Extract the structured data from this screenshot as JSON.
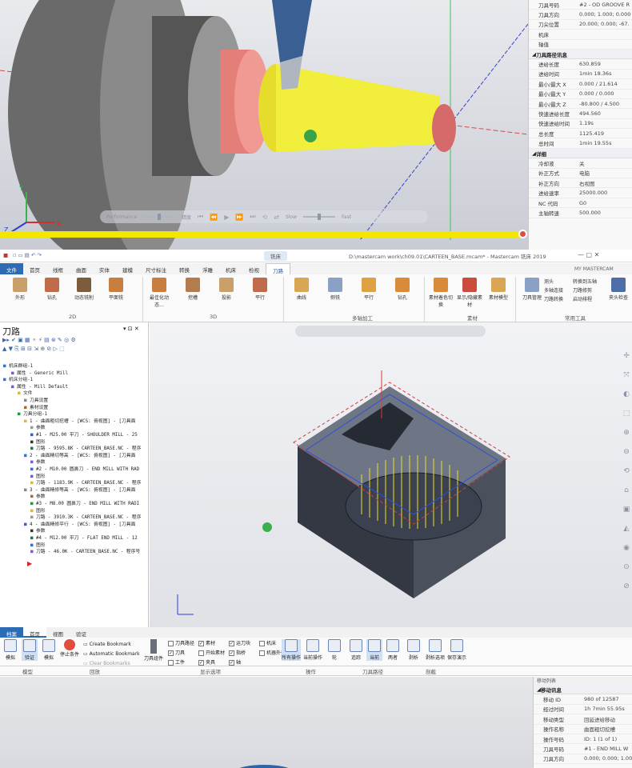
{
  "panel1": {
    "playbar": {
      "performance": "Performance",
      "accuracy": "精度",
      "slow": "Slow",
      "fast": "Fast"
    },
    "props": {
      "top_rows": [
        {
          "k": "刀具号码",
          "v": "#2 - OD GROOVE R"
        },
        {
          "k": "刀具方向",
          "v": "0.000; 1.000; 0.000"
        },
        {
          "k": "刀尖位置",
          "v": "20.000; 0.000; -67."
        },
        {
          "k": "机床",
          "v": ""
        },
        {
          "k": "轴值",
          "v": ""
        }
      ],
      "section1": "刀具路径讯息",
      "rows1": [
        {
          "k": "进给长度",
          "v": "630.859"
        },
        {
          "k": "进给时间",
          "v": "1min 18.36s"
        },
        {
          "k": "最小/最大 X",
          "v": "0.000 / 21.614"
        },
        {
          "k": "最小/最大 Y",
          "v": "0.000 / 0.000"
        },
        {
          "k": "最小/最大 Z",
          "v": "-80.800 / 4.500"
        },
        {
          "k": "快速进给长度",
          "v": "494.560"
        },
        {
          "k": "快速进给时间",
          "v": "1.19s"
        },
        {
          "k": "总长度",
          "v": "1125.419"
        },
        {
          "k": "总时间",
          "v": "1min 19.55s"
        }
      ],
      "section2": "详细",
      "rows2": [
        {
          "k": "冷却液",
          "v": "关"
        },
        {
          "k": "补正方式",
          "v": "电脑"
        },
        {
          "k": "补正方向",
          "v": "右视图"
        },
        {
          "k": "进给速率",
          "v": "25000.000"
        },
        {
          "k": "NC 代码",
          "v": "G0"
        },
        {
          "k": "主轴转速",
          "v": "500.000"
        }
      ]
    }
  },
  "panel2": {
    "window_title": "D:\\mastercam work\\ch09.01\\CARTEEN_BASE.mcam* - Mastercam 铣床 2019",
    "context_tab": "铣床",
    "account": "MY MASTERCAM",
    "tabs": [
      "文件",
      "首页",
      "线框",
      "曲面",
      "实体",
      "建模",
      "尺寸标注",
      "转换",
      "浮雕",
      "机床",
      "检视",
      "刀路"
    ],
    "ribbon": {
      "btns_2d": [
        "外形",
        "钻孔",
        "动态铣削",
        "平面铣"
      ],
      "btns_3d": [
        "最佳化动态...",
        "挖槽",
        "投影",
        "平行"
      ],
      "btns_multi": [
        "曲线",
        "侧铣",
        "平行",
        "钻孔"
      ],
      "btns_stock": [
        "素材着色切换",
        "显示/隐藏素材",
        "素材模型"
      ],
      "btns_util": [
        "刀具管理"
      ],
      "small_util": [
        "测头",
        "多轴连接",
        "刀路转换",
        "转换到五轴",
        "刀路修剪",
        "启动排程"
      ],
      "btn_clamp": "夹头检查",
      "groups": [
        "2D",
        "3D",
        "多轴加工",
        "素材",
        "常用工具"
      ]
    },
    "tree": {
      "title": "刀路",
      "lines": [
        "机床群组-1",
        "属性 - Generic Mill",
        "机床分组-1",
        "属性 - Mill Default",
        "文件",
        "刀具设置",
        "素材设置",
        "刀具分组-1",
        "1 - 曲面粗切挖槽 - [WCS: 俯视图] - [刀具面",
        "参数",
        "#1 - M25.00 平刀 - SHOULDER MILL - 25",
        "图形",
        "刀路 - 9595.8K - CARTEEN_BASE.NC - 程序",
        "2 - 曲面精切等高 - [WCS: 俯视图] - [刀具面",
        "参数",
        "#2 - M10.00 圆鼻刀 - END MILL WITH RAD",
        "图形",
        "刀路 - 1183.9K - CARTEEN_BASE.NC - 程序",
        "3 - 曲面精修等高 - [WCS: 俯视图] - [刀具面",
        "参数",
        "#3 - M8.00 圆鼻刀 - END MILL WITH RADI",
        "图形",
        "刀路 - 3910.3K - CARTEEN_BASE.NC - 程序",
        "4 - 曲面精修平行 - [WCS: 俯视图] - [刀具面",
        "参数",
        "#4 - M12.00 平刀 - FLAT END MILL - 12",
        "图形",
        "刀路 - 46.0K - CARTEEN_BASE.NC - 程序号"
      ]
    }
  },
  "panel3": {
    "tabs": [
      "档案",
      "首页",
      "视图",
      "验证"
    ],
    "btns": [
      "模拟",
      "验证",
      "模拟"
    ],
    "bookmark": [
      "Create Bookmark",
      "Automatic Bookmark",
      "Clear Bookmarks"
    ],
    "stop_label": "停止条件",
    "tool_group": "刀具组件",
    "checks": [
      "刀具路径",
      "素材",
      "运刀块",
      "机床",
      "刀具",
      "开始素材",
      "指桥",
      "机器外壳",
      "工件",
      "夹具",
      "轴"
    ],
    "ops": [
      "所有操作",
      "当前操作",
      "轮"
    ],
    "paths": [
      "追踪",
      "当前",
      "两者"
    ],
    "cut": [
      "剥析",
      "剥析选项",
      "保存演示"
    ],
    "groups": [
      "模型",
      "回放",
      "显示选项",
      "操作",
      "刀具路径",
      "剖截"
    ],
    "list_title": "移动列表",
    "section": "移动讯息",
    "rows": [
      {
        "k": "移动 ID",
        "v": "980 of 12587"
      },
      {
        "k": "经过时间",
        "v": "1h 7min 55.95s"
      },
      {
        "k": "移动类型",
        "v": "回延进给移动"
      },
      {
        "k": "操作名称",
        "v": "曲面粗切挖槽"
      },
      {
        "k": "操作号码",
        "v": "ID: 1 (1 of 1)"
      },
      {
        "k": "刀具号码",
        "v": "#1 - END MILL W"
      },
      {
        "k": "刀具方向",
        "v": "0.000; 0.000; 1.000"
      }
    ]
  }
}
